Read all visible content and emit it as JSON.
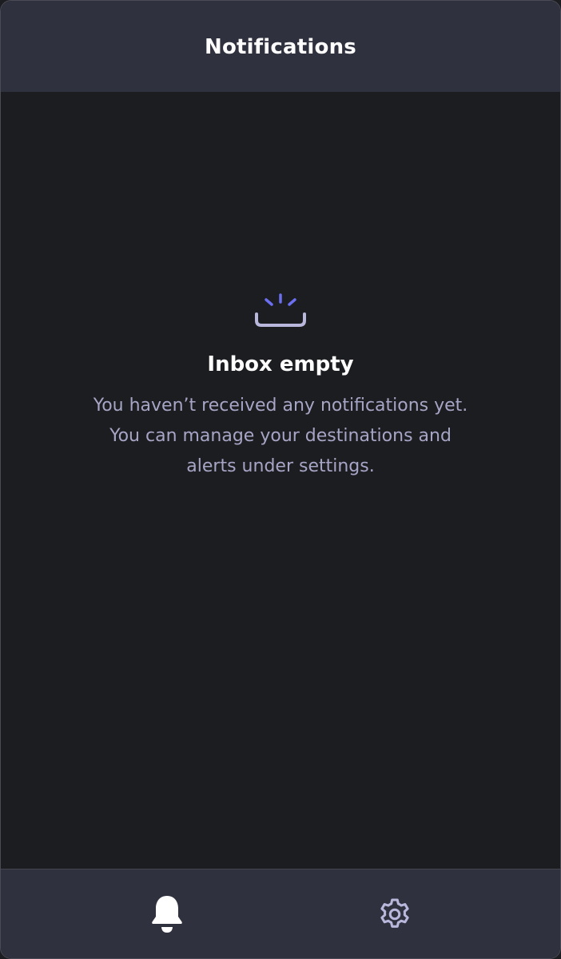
{
  "header": {
    "title": "Notifications"
  },
  "empty_state": {
    "icon": "inbox-empty-icon",
    "title": "Inbox empty",
    "lines": [
      "You haven’t received any notifications yet.",
      "You can manage your destinations and",
      "alerts under settings."
    ]
  },
  "footer": {
    "tabs": [
      {
        "icon": "bell-icon",
        "active": true
      },
      {
        "icon": "gear-icon",
        "active": false
      }
    ]
  },
  "colors": {
    "background": "#1c1d21",
    "bar": "#30313f",
    "muted_text": "#a7a5c6",
    "accent": "#6b6ff0",
    "icon_muted": "#b9b7db"
  }
}
